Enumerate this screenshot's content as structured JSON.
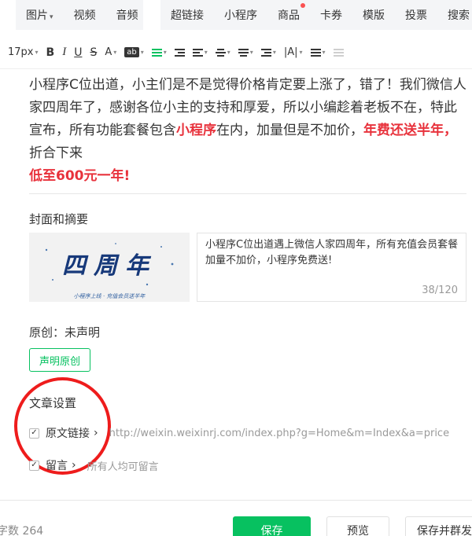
{
  "insert_toolbar": {
    "group1": [
      {
        "label": "图片",
        "caret": "▾"
      },
      {
        "label": "视频"
      },
      {
        "label": "音频"
      }
    ],
    "group2": [
      {
        "label": "超链接"
      },
      {
        "label": "小程序"
      },
      {
        "label": "商品",
        "badge": true
      },
      {
        "label": "卡券"
      },
      {
        "label": "模版"
      },
      {
        "label": "投票"
      },
      {
        "label": "搜索"
      }
    ]
  },
  "format_toolbar": {
    "font_size": "17px",
    "bold": "B",
    "italic": "I",
    "underline": "U",
    "strike": "S",
    "font_color": "A",
    "bg_color": "ab",
    "line_spacing": "|A|"
  },
  "article": {
    "part1": "小程序C位出道，小主们是不是觉得价格肯定要上涨了，错了！我们微信人家四周年了，感谢各位小主的支持和厚爱，所以小编趁着老板不在，特此宣布，所有功能套餐包含",
    "hl1": "小程序",
    "part2": "在内，加量但是不加价，",
    "hl2": "年费还送半年，",
    "part3": "折合下来",
    "hl3": "低至600元一年!"
  },
  "cover_section": {
    "title": "封面和摘要",
    "cover_art": {
      "main_text": "四周年",
      "sub_text": "小程序上线 · 充值会员送半年"
    },
    "summary": "小程序C位出道遇上微信人家四周年，所有充值会员套餐加量不加价，小程序免费送!",
    "count": "38/120"
  },
  "original": {
    "label": "原创：未声明",
    "button": "声明原创"
  },
  "settings": {
    "title": "文章设置",
    "source_link": {
      "check": "✓",
      "label": "原文链接",
      "chevron": "›",
      "value": "http://weixin.weixinrj.com/index.php?g=Home&m=Index&a=price"
    },
    "comments": {
      "check": "✓",
      "label": "留言",
      "chevron": "›",
      "value": "所有人均可留言"
    }
  },
  "footer": {
    "word_count": "字数 264",
    "save": "保存",
    "preview": "预览",
    "publish": "保存并群发"
  },
  "colors": {
    "accent": "#07c160",
    "highlight": "#e8323c",
    "annotation": "#ee1c1c"
  }
}
